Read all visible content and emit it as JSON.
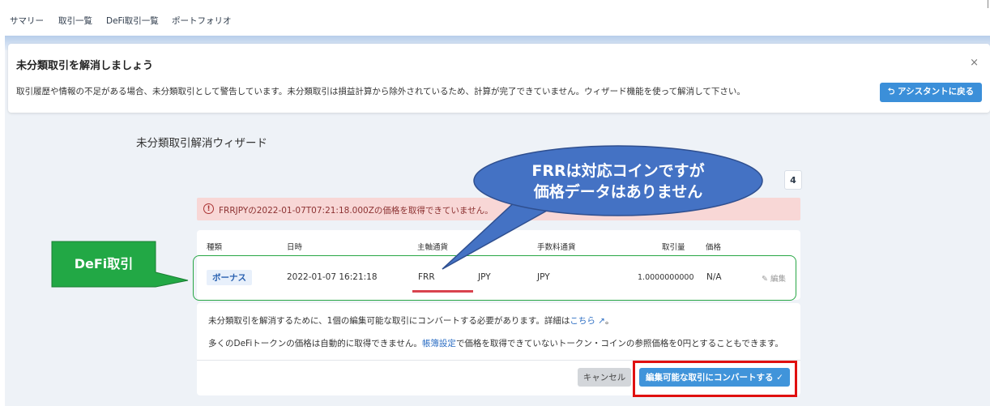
{
  "nav": {
    "items": [
      "サマリー",
      "取引一覧",
      "DeFi取引一覧",
      "ポートフォリオ"
    ]
  },
  "alert": {
    "title": "未分類取引を解消しましょう",
    "close": "×",
    "description": "取引履歴や情報の不足がある場合、未分類取引として警告しています。未分類取引は損益計算から除外されているため、計算が完了できていません。ウィザード機能を使って解消して下さい。",
    "assistant_button": "⮌ アシスタントに戻る"
  },
  "wizard": {
    "title": "未分類取引解消ウィザード",
    "step": "4",
    "error_icon": "!",
    "error_message": "FRRJPYの2022-01-07T07:21:18.000Zの価格を取得できていません。"
  },
  "table": {
    "headers": [
      "種類",
      "日時",
      "主軸通貨",
      "手数料通貨",
      "取引量",
      "価格"
    ],
    "row": {
      "type": "ボーナス",
      "datetime": "2022-01-07 16:21:18",
      "base": "FRR",
      "quote": "JPY",
      "fee": "JPY",
      "amount": "1.0000000000",
      "price": "N/A",
      "edit": "✎ 編集"
    }
  },
  "info": {
    "line1_prefix": "未分類取引を解消するために、1個の編集可能な取引にコンバートする必要があります。詳細は",
    "line1_link": "こちら ↗",
    "line1_suffix": "。",
    "line2_prefix": "多くのDeFiトークンの価格は自動的に取得できません。",
    "line2_link": "帳簿設定",
    "line2_suffix": "で価格を取得できていないトークン・コインの参照価格を0円とすることもできます。"
  },
  "buttons": {
    "cancel": "キャンセル",
    "convert": "編集可能な取引にコンバートする ✓"
  },
  "annotations": {
    "callout": "FRRは対応コインですが\n価格データはありません",
    "defi_label": "DeFi取引",
    "callout_color": "#4472c4",
    "defi_color": "#22a845",
    "highlight_color": "#e01010"
  }
}
